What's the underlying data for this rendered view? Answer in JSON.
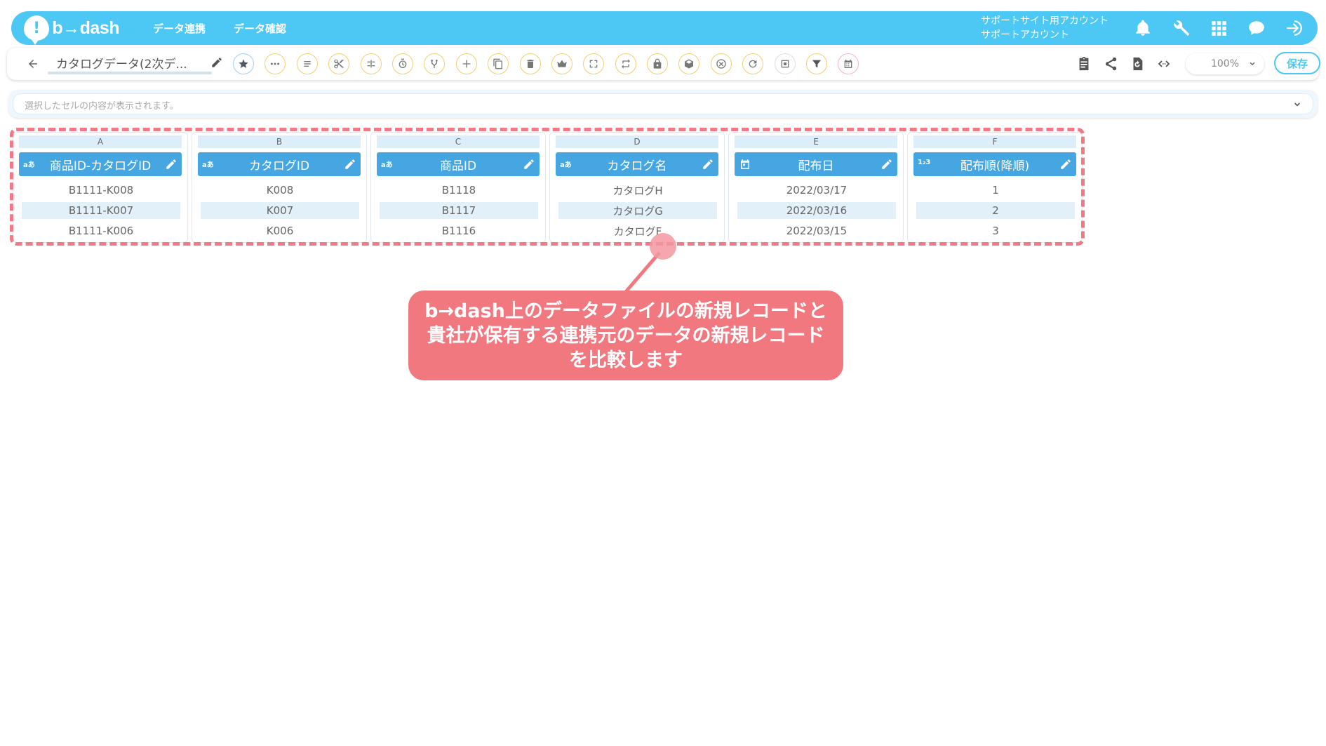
{
  "header": {
    "logo_mark": "!",
    "logo_text": "b→dash",
    "nav": [
      "データ連携",
      "データ確認"
    ],
    "account_line1": "サポートサイト用アカウント",
    "account_line2": "サポートアカウント",
    "icons": [
      "bell-icon",
      "wrench-icon",
      "grid-icon",
      "chat-icon",
      "logout-icon"
    ],
    "brand_color": "#4dc8f5"
  },
  "toolbar": {
    "file_title": "カタログデータ(2次デ...",
    "zoom": "100%",
    "save_label": "保存",
    "tools": [
      "star-icon",
      "dots-icon",
      "list-icon",
      "scissors-icon",
      "merge-icon",
      "timer-icon",
      "branch-icon",
      "plus-icon",
      "copy-icon",
      "trash-icon",
      "crown-icon",
      "expand-icon",
      "repeat-icon",
      "lock-icon",
      "box-icon",
      "close-circle-icon",
      "refresh-icon",
      "frame-icon",
      "filter-icon",
      "calendar-grid-icon"
    ],
    "right_icons": [
      "clipboard-icon",
      "share-icon",
      "history-icon",
      "code-icon"
    ]
  },
  "cellbar": {
    "placeholder": "選択したセルの内容が表示されます。"
  },
  "columns": [
    {
      "letter": "A",
      "type": "aあ",
      "name": "商品ID-カタログID",
      "values": [
        "B1111-K008",
        "B1111-K007",
        "B1111-K006"
      ]
    },
    {
      "letter": "B",
      "type": "aあ",
      "name": "カタログID",
      "values": [
        "K008",
        "K007",
        "K006"
      ]
    },
    {
      "letter": "C",
      "type": "aあ",
      "name": "商品ID",
      "values": [
        "B1118",
        "B1117",
        "B1116"
      ]
    },
    {
      "letter": "D",
      "type": "aあ",
      "name": "カタログ名",
      "values": [
        "カタログH",
        "カタログG",
        "カタログF"
      ]
    },
    {
      "letter": "E",
      "type": "",
      "name": "配布日",
      "values": [
        "2022/03/17",
        "2022/03/16",
        "2022/03/15"
      ]
    },
    {
      "letter": "F",
      "type": "1₂3",
      "name": "配布順(降順)",
      "values": [
        "1",
        "2",
        "3"
      ]
    }
  ],
  "callout": {
    "line1": "b→dash上のデータファイルの新規レコードと",
    "line2": "貴社が保有する連携元のデータの新規レコード",
    "line3": "を比較します",
    "color": "#f27880"
  }
}
